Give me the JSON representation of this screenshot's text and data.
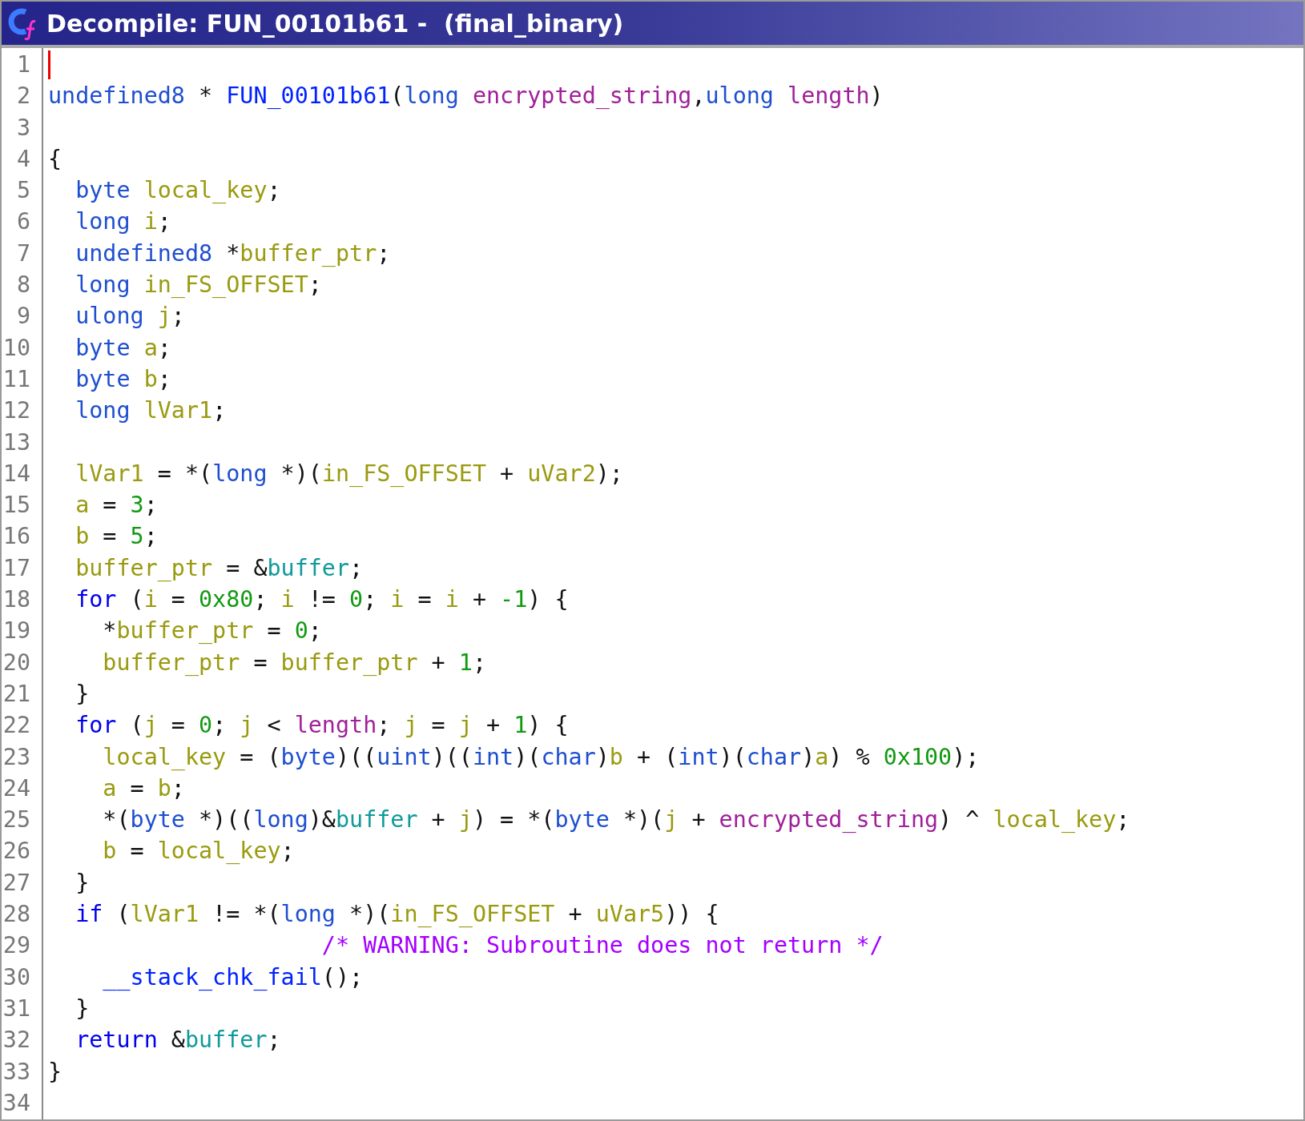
{
  "window": {
    "title": "Decompile: FUN_00101b61 -  (final_binary)"
  },
  "editor": {
    "lines": [
      {
        "number": "1",
        "cursor": true
      },
      {
        "number": "2",
        "cursor": false,
        "tokens": [
          {
            "kind": "type",
            "text": "undefined8"
          },
          {
            "kind": "plain",
            "text": " * "
          },
          {
            "kind": "function",
            "text": "FUN_00101b61"
          },
          {
            "kind": "plain",
            "text": "("
          },
          {
            "kind": "type",
            "text": "long"
          },
          {
            "kind": "param",
            "text": " encrypted_string"
          },
          {
            "kind": "plain",
            "text": ","
          },
          {
            "kind": "type",
            "text": "ulong"
          },
          {
            "kind": "param",
            "text": " length"
          },
          {
            "kind": "plain",
            "text": ")"
          }
        ]
      },
      {
        "number": "3",
        "cursor": false
      },
      {
        "number": "4",
        "cursor": false,
        "tokens": [
          {
            "kind": "plain",
            "text": "{"
          }
        ]
      },
      {
        "number": "5",
        "cursor": false,
        "tokens": [
          {
            "kind": "type",
            "text": "  byte"
          },
          {
            "kind": "variable",
            "text": " local_key"
          },
          {
            "kind": "plain",
            "text": ";"
          }
        ]
      },
      {
        "number": "6",
        "cursor": false,
        "tokens": [
          {
            "kind": "type",
            "text": "  long"
          },
          {
            "kind": "variable",
            "text": " i"
          },
          {
            "kind": "plain",
            "text": ";"
          }
        ]
      },
      {
        "number": "7",
        "cursor": false,
        "tokens": [
          {
            "kind": "type",
            "text": "  undefined8"
          },
          {
            "kind": "plain",
            "text": " *"
          },
          {
            "kind": "variable",
            "text": "buffer_ptr"
          },
          {
            "kind": "plain",
            "text": ";"
          }
        ]
      },
      {
        "number": "8",
        "cursor": false,
        "tokens": [
          {
            "kind": "type",
            "text": "  long"
          },
          {
            "kind": "variable",
            "text": " in_FS_OFFSET"
          },
          {
            "kind": "plain",
            "text": ";"
          }
        ]
      },
      {
        "number": "9",
        "cursor": false,
        "tokens": [
          {
            "kind": "type",
            "text": "  ulong"
          },
          {
            "kind": "variable",
            "text": " j"
          },
          {
            "kind": "plain",
            "text": ";"
          }
        ]
      },
      {
        "number": "10",
        "cursor": false,
        "tokens": [
          {
            "kind": "type",
            "text": "  byte"
          },
          {
            "kind": "variable",
            "text": " a"
          },
          {
            "kind": "plain",
            "text": ";"
          }
        ]
      },
      {
        "number": "11",
        "cursor": false,
        "tokens": [
          {
            "kind": "type",
            "text": "  byte"
          },
          {
            "kind": "variable",
            "text": " b"
          },
          {
            "kind": "plain",
            "text": ";"
          }
        ]
      },
      {
        "number": "12",
        "cursor": false,
        "tokens": [
          {
            "kind": "type",
            "text": "  long"
          },
          {
            "kind": "variable",
            "text": " lVar1"
          },
          {
            "kind": "plain",
            "text": ";"
          }
        ]
      },
      {
        "number": "13",
        "cursor": false
      },
      {
        "number": "14",
        "cursor": false,
        "tokens": [
          {
            "kind": "variable",
            "text": "  lVar1"
          },
          {
            "kind": "plain",
            "text": " = *("
          },
          {
            "kind": "type",
            "text": "long"
          },
          {
            "kind": "plain",
            "text": " *)("
          },
          {
            "kind": "variable",
            "text": "in_FS_OFFSET"
          },
          {
            "kind": "plain",
            "text": " + "
          },
          {
            "kind": "variable",
            "text": "uVar2"
          },
          {
            "kind": "plain",
            "text": ");"
          }
        ]
      },
      {
        "number": "15",
        "cursor": false,
        "tokens": [
          {
            "kind": "variable",
            "text": "  a"
          },
          {
            "kind": "plain",
            "text": " = "
          },
          {
            "kind": "constant",
            "text": "3"
          },
          {
            "kind": "plain",
            "text": ";"
          }
        ]
      },
      {
        "number": "16",
        "cursor": false,
        "tokens": [
          {
            "kind": "variable",
            "text": "  b"
          },
          {
            "kind": "plain",
            "text": " = "
          },
          {
            "kind": "constant",
            "text": "5"
          },
          {
            "kind": "plain",
            "text": ";"
          }
        ]
      },
      {
        "number": "17",
        "cursor": false,
        "tokens": [
          {
            "kind": "variable",
            "text": "  buffer_ptr"
          },
          {
            "kind": "plain",
            "text": " = &"
          },
          {
            "kind": "global",
            "text": "buffer"
          },
          {
            "kind": "plain",
            "text": ";"
          }
        ]
      },
      {
        "number": "18",
        "cursor": false,
        "tokens": [
          {
            "kind": "keyword",
            "text": "  for"
          },
          {
            "kind": "plain",
            "text": " ("
          },
          {
            "kind": "variable",
            "text": "i"
          },
          {
            "kind": "plain",
            "text": " = "
          },
          {
            "kind": "constant",
            "text": "0x80"
          },
          {
            "kind": "plain",
            "text": "; "
          },
          {
            "kind": "variable",
            "text": "i"
          },
          {
            "kind": "plain",
            "text": " != "
          },
          {
            "kind": "constant",
            "text": "0"
          },
          {
            "kind": "plain",
            "text": "; "
          },
          {
            "kind": "variable",
            "text": "i"
          },
          {
            "kind": "plain",
            "text": " = "
          },
          {
            "kind": "variable",
            "text": "i"
          },
          {
            "kind": "plain",
            "text": " + "
          },
          {
            "kind": "constant",
            "text": "-1"
          },
          {
            "kind": "plain",
            "text": ") {"
          }
        ]
      },
      {
        "number": "19",
        "cursor": false,
        "tokens": [
          {
            "kind": "plain",
            "text": "    *"
          },
          {
            "kind": "variable",
            "text": "buffer_ptr"
          },
          {
            "kind": "plain",
            "text": " = "
          },
          {
            "kind": "constant",
            "text": "0"
          },
          {
            "kind": "plain",
            "text": ";"
          }
        ]
      },
      {
        "number": "20",
        "cursor": false,
        "tokens": [
          {
            "kind": "variable",
            "text": "    buffer_ptr"
          },
          {
            "kind": "plain",
            "text": " = "
          },
          {
            "kind": "variable",
            "text": "buffer_ptr"
          },
          {
            "kind": "plain",
            "text": " + "
          },
          {
            "kind": "constant",
            "text": "1"
          },
          {
            "kind": "plain",
            "text": ";"
          }
        ]
      },
      {
        "number": "21",
        "cursor": false,
        "tokens": [
          {
            "kind": "plain",
            "text": "  }"
          }
        ]
      },
      {
        "number": "22",
        "cursor": false,
        "tokens": [
          {
            "kind": "keyword",
            "text": "  for"
          },
          {
            "kind": "plain",
            "text": " ("
          },
          {
            "kind": "variable",
            "text": "j"
          },
          {
            "kind": "plain",
            "text": " = "
          },
          {
            "kind": "constant",
            "text": "0"
          },
          {
            "kind": "plain",
            "text": "; "
          },
          {
            "kind": "variable",
            "text": "j"
          },
          {
            "kind": "plain",
            "text": " < "
          },
          {
            "kind": "param",
            "text": "length"
          },
          {
            "kind": "plain",
            "text": "; "
          },
          {
            "kind": "variable",
            "text": "j"
          },
          {
            "kind": "plain",
            "text": " = "
          },
          {
            "kind": "variable",
            "text": "j"
          },
          {
            "kind": "plain",
            "text": " + "
          },
          {
            "kind": "constant",
            "text": "1"
          },
          {
            "kind": "plain",
            "text": ") {"
          }
        ]
      },
      {
        "number": "23",
        "cursor": false,
        "tokens": [
          {
            "kind": "variable",
            "text": "    local_key"
          },
          {
            "kind": "plain",
            "text": " = ("
          },
          {
            "kind": "type",
            "text": "byte"
          },
          {
            "kind": "plain",
            "text": ")(("
          },
          {
            "kind": "type",
            "text": "uint"
          },
          {
            "kind": "plain",
            "text": ")(("
          },
          {
            "kind": "type",
            "text": "int"
          },
          {
            "kind": "plain",
            "text": ")("
          },
          {
            "kind": "type",
            "text": "char"
          },
          {
            "kind": "plain",
            "text": ")"
          },
          {
            "kind": "variable",
            "text": "b"
          },
          {
            "kind": "plain",
            "text": " + ("
          },
          {
            "kind": "type",
            "text": "int"
          },
          {
            "kind": "plain",
            "text": ")("
          },
          {
            "kind": "type",
            "text": "char"
          },
          {
            "kind": "plain",
            "text": ")"
          },
          {
            "kind": "variable",
            "text": "a"
          },
          {
            "kind": "plain",
            "text": ") % "
          },
          {
            "kind": "constant",
            "text": "0x100"
          },
          {
            "kind": "plain",
            "text": ");"
          }
        ]
      },
      {
        "number": "24",
        "cursor": false,
        "tokens": [
          {
            "kind": "variable",
            "text": "    a"
          },
          {
            "kind": "plain",
            "text": " = "
          },
          {
            "kind": "variable",
            "text": "b"
          },
          {
            "kind": "plain",
            "text": ";"
          }
        ]
      },
      {
        "number": "25",
        "cursor": false,
        "tokens": [
          {
            "kind": "plain",
            "text": "    *("
          },
          {
            "kind": "type",
            "text": "byte"
          },
          {
            "kind": "plain",
            "text": " *)(("
          },
          {
            "kind": "type",
            "text": "long"
          },
          {
            "kind": "plain",
            "text": ")&"
          },
          {
            "kind": "global",
            "text": "buffer"
          },
          {
            "kind": "plain",
            "text": " + "
          },
          {
            "kind": "variable",
            "text": "j"
          },
          {
            "kind": "plain",
            "text": ") = *("
          },
          {
            "kind": "type",
            "text": "byte"
          },
          {
            "kind": "plain",
            "text": " *)("
          },
          {
            "kind": "variable",
            "text": "j"
          },
          {
            "kind": "plain",
            "text": " + "
          },
          {
            "kind": "param",
            "text": "encrypted_string"
          },
          {
            "kind": "plain",
            "text": ") ^ "
          },
          {
            "kind": "variable",
            "text": "local_key"
          },
          {
            "kind": "plain",
            "text": ";"
          }
        ]
      },
      {
        "number": "26",
        "cursor": false,
        "tokens": [
          {
            "kind": "variable",
            "text": "    b"
          },
          {
            "kind": "plain",
            "text": " = "
          },
          {
            "kind": "variable",
            "text": "local_key"
          },
          {
            "kind": "plain",
            "text": ";"
          }
        ]
      },
      {
        "number": "27",
        "cursor": false,
        "tokens": [
          {
            "kind": "plain",
            "text": "  }"
          }
        ]
      },
      {
        "number": "28",
        "cursor": false,
        "tokens": [
          {
            "kind": "keyword",
            "text": "  if"
          },
          {
            "kind": "plain",
            "text": " ("
          },
          {
            "kind": "variable",
            "text": "lVar1"
          },
          {
            "kind": "plain",
            "text": " != *("
          },
          {
            "kind": "type",
            "text": "long"
          },
          {
            "kind": "plain",
            "text": " *)("
          },
          {
            "kind": "variable",
            "text": "in_FS_OFFSET"
          },
          {
            "kind": "plain",
            "text": " + "
          },
          {
            "kind": "variable",
            "text": "uVar5"
          },
          {
            "kind": "plain",
            "text": ")) {"
          }
        ]
      },
      {
        "number": "29",
        "cursor": false,
        "tokens": [
          {
            "kind": "comment",
            "text": "                    /* WARNING: Subroutine does not return */"
          }
        ]
      },
      {
        "number": "30",
        "cursor": false,
        "tokens": [
          {
            "kind": "function_call",
            "text": "    __stack_chk_fail"
          },
          {
            "kind": "plain",
            "text": "();"
          }
        ]
      },
      {
        "number": "31",
        "cursor": false,
        "tokens": [
          {
            "kind": "plain",
            "text": "  }"
          }
        ]
      },
      {
        "number": "32",
        "cursor": false,
        "tokens": [
          {
            "kind": "keyword",
            "text": "  return"
          },
          {
            "kind": "plain",
            "text": " &"
          },
          {
            "kind": "global",
            "text": "buffer"
          },
          {
            "kind": "plain",
            "text": ";"
          }
        ]
      },
      {
        "number": "33",
        "cursor": false,
        "tokens": [
          {
            "kind": "plain",
            "text": "}"
          }
        ]
      },
      {
        "number": "34",
        "cursor": false
      }
    ]
  }
}
